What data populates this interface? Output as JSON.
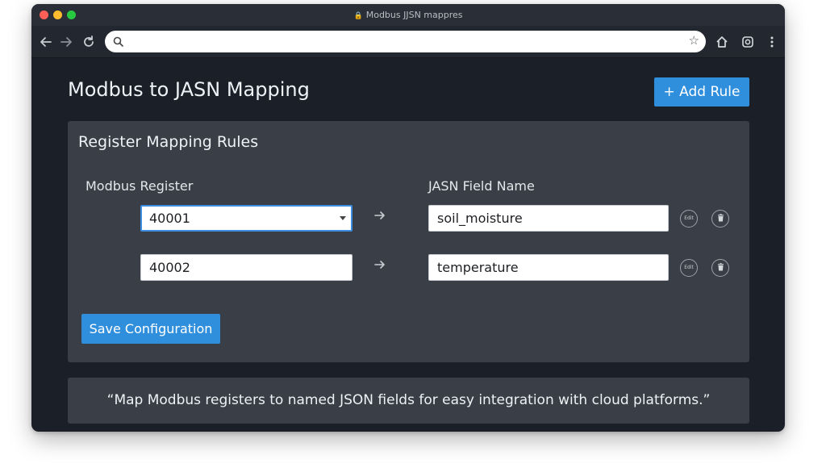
{
  "window": {
    "title": "Modbus JJSN mappres"
  },
  "toolbar": {
    "back_icon": "back-arrow-icon",
    "forward_icon": "forward-arrow-icon",
    "reload_icon": "reload-icon",
    "search_placeholder": "",
    "bookmark_icon": "star-icon",
    "home_icon": "home-icon",
    "extension_icon": "extension-icon",
    "menu_icon": "kebab-menu-icon"
  },
  "page": {
    "title": "Modbus to JASN Mapping",
    "add_rule_label": "+ Add Rule"
  },
  "panel": {
    "title": "Register Mapping Rules",
    "columns": {
      "register": "Modbus Register",
      "field": "JASN Field Name"
    },
    "rows": [
      {
        "register": "40001",
        "field": "soil_moisture",
        "edit_label": "Edit"
      },
      {
        "register": "40002",
        "field": "temperature",
        "edit_label": "Edit"
      }
    ],
    "save_label": "Save Configuration"
  },
  "note": {
    "text": "“Map Modbus registers to named JSON fields for easy integration with cloud platforms.”"
  },
  "colors": {
    "accent": "#2f8fdd",
    "background": "#1b2028",
    "panel": "#3a3f47"
  }
}
